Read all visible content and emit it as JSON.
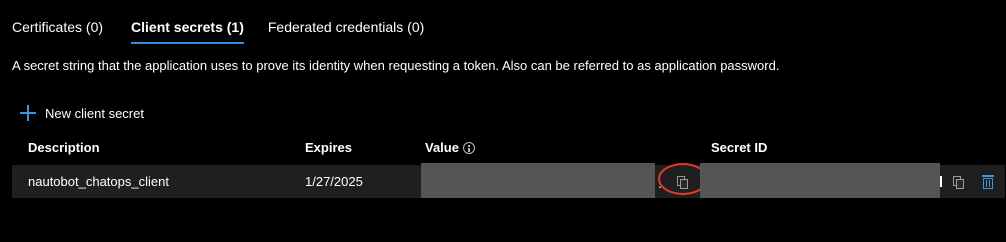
{
  "tabs": [
    {
      "label": "Certificates (0)",
      "active": false
    },
    {
      "label": "Client secrets (1)",
      "active": true
    },
    {
      "label": "Federated credentials (0)",
      "active": false
    }
  ],
  "description": "A secret string that the application uses to prove its identity when requesting a token. Also can be referred to as application password.",
  "toolbar": {
    "new_secret_label": "New client secret"
  },
  "table": {
    "columns": [
      "Description",
      "Expires",
      "Value",
      "Secret ID"
    ],
    "rows": [
      {
        "description": "nautobot_chatops_client",
        "expires": "1/27/2025",
        "value_truncated": "..",
        "value_masked": true,
        "secret_id_masked": true
      }
    ]
  },
  "colors": {
    "background": "#000000",
    "row_background": "#1f1f1f",
    "mask": "#555555",
    "accent": "#2f8ee8",
    "highlight": "#e23a2a",
    "text": "#ffffff"
  },
  "icons": [
    "plus-icon",
    "info-icon",
    "copy-icon",
    "trash-icon"
  ]
}
